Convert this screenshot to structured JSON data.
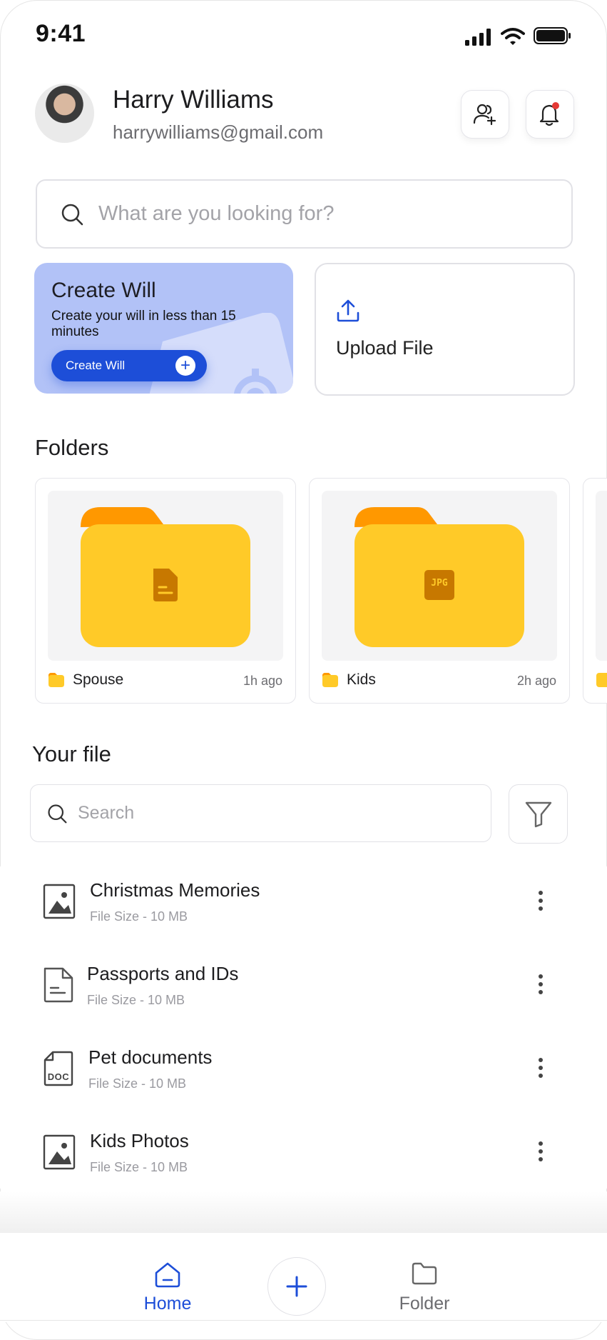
{
  "status_bar": {
    "time": "9:41"
  },
  "header": {
    "user_name": "Harry Williams",
    "user_email": "harrywilliams@gmail.com"
  },
  "search": {
    "placeholder": "What are you looking for?"
  },
  "create_will": {
    "title": "Create Will",
    "subtitle": "Create your will in less than 15 minutes",
    "button_label": "Create Will"
  },
  "upload": {
    "label": "Upload File"
  },
  "folders": {
    "title": "Folders",
    "items": [
      {
        "name": "Spouse",
        "time": "1h ago",
        "badge": ""
      },
      {
        "name": "Kids",
        "time": "2h ago",
        "badge": "JPG"
      }
    ]
  },
  "files": {
    "title": "Your file",
    "search_placeholder": "Search",
    "items": [
      {
        "name": "Christmas Memories",
        "size": "File Size - 10 MB",
        "icon": "image-file-icon"
      },
      {
        "name": "Passports and IDs",
        "size": "File Size - 10 MB",
        "icon": "document-file-icon"
      },
      {
        "name": "Pet documents",
        "size": "File Size - 10 MB",
        "icon": "doc-file-icon",
        "icon_text": "DOC"
      },
      {
        "name": "Kids Photos",
        "size": "File Size - 10 MB",
        "icon": "image-file-icon"
      }
    ]
  },
  "tabbar": {
    "home_label": "Home",
    "folder_label": "Folder",
    "active": "home"
  },
  "colors": {
    "accent": "#1d4ed8",
    "will_card_bg": "#b2c2f7",
    "folder_yellow": "#ffca28",
    "folder_orange": "#ff9800",
    "notification_dot": "#e53935"
  }
}
